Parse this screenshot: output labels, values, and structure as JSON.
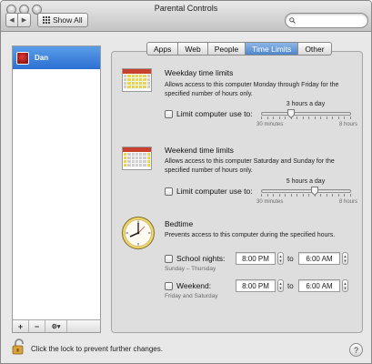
{
  "window": {
    "title": "Parental Controls"
  },
  "toolbar": {
    "show_all_label": "Show All",
    "search": {
      "value": "",
      "placeholder": ""
    }
  },
  "sidebar": {
    "users": [
      {
        "name": "Dan",
        "selected": true
      }
    ],
    "buttons": {
      "add": "+",
      "remove": "−",
      "action": "⚙▾"
    }
  },
  "tabs": [
    {
      "label": "Apps",
      "active": false
    },
    {
      "label": "Web",
      "active": false
    },
    {
      "label": "People",
      "active": false
    },
    {
      "label": "Time Limits",
      "active": true
    },
    {
      "label": "Other",
      "active": false
    }
  ],
  "weekday": {
    "title": "Weekday time limits",
    "description": "Allows access to this computer Monday through Friday for the specified number of hours only.",
    "checkbox_label": "Limit computer use to:",
    "checked": false,
    "value_label": "3 hours a day",
    "hours": 3,
    "min_label": "30 minutes",
    "max_label": "8 hours",
    "min_hours": 0.5,
    "max_hours": 8
  },
  "weekend": {
    "title": "Weekend time limits",
    "description": "Allows access to this computer Saturday and Sunday for the specified number of hours only.",
    "checkbox_label": "Limit computer use to:",
    "checked": false,
    "value_label": "5 hours a day",
    "hours": 5,
    "min_label": "30 minutes",
    "max_label": "8 hours",
    "min_hours": 0.5,
    "max_hours": 8
  },
  "bedtime": {
    "title": "Bedtime",
    "description": "Prevents access to this computer during the specified hours.",
    "school_nights": {
      "label": "School nights:",
      "sub": "Sunday – Thursday",
      "checked": false,
      "from": "8:00 PM",
      "to": "6:00 AM"
    },
    "weekend": {
      "label": "Weekend:",
      "sub": "Friday and Saturday",
      "checked": false,
      "from": "8:00 PM",
      "to": "6:00 AM"
    },
    "to_label": "to"
  },
  "footer": {
    "lock_text": "Click the lock to prevent further changes.",
    "help_label": "?"
  },
  "colors": {
    "selection": "#2b6fd3",
    "active_tab": "#4d86cd",
    "calendar_header": "#c8412f",
    "calendar_highlight": "#f0d34a",
    "clock_hand": "#c0392b"
  },
  "icons": [
    "search-icon",
    "calendar-icon",
    "clock-icon",
    "lock-icon",
    "help-icon",
    "grid-icon",
    "gear-icon"
  ]
}
